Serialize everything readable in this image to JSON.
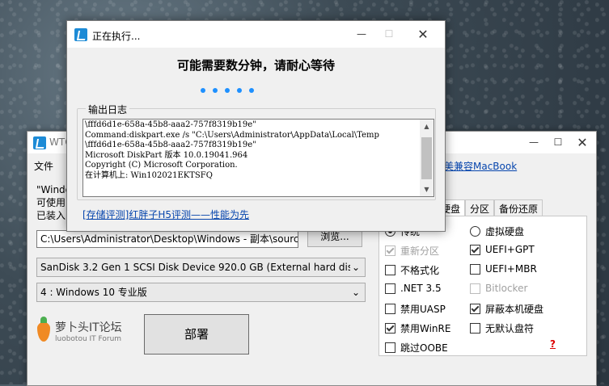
{
  "main": {
    "title": "WTG",
    "menu_file": "文件",
    "top_link": "美兼容MacBook",
    "desc_lines": [
      "\"Windo",
      "可使用",
      "已装入"
    ],
    "path_value": "C:\\Users\\Administrator\\Desktop\\Windows - 副本\\sources",
    "browse_label": "浏览...",
    "disk_value": "SanDisk 3.2 Gen 1 SCSI Disk Device 920.0 GB (External hard disk",
    "edition_value": "4 : Windows 10 专业版",
    "deploy_label": "部署",
    "logo_cn": "萝卜头IT论坛",
    "logo_en": "luobotou IT Forum",
    "tabs": [
      "硬盘",
      "分区",
      "备份还原"
    ],
    "options": {
      "traditional": "传统",
      "vhd": "虚拟硬盘",
      "repartition": "重新分区",
      "uefi_gpt": "UEFI+GPT",
      "no_format": "不格式化",
      "uefi_mbr": "UEFI+MBR",
      "net35": ".NET 3.5",
      "bitlocker": "Bitlocker",
      "disable_uasp": "禁用UASP",
      "hide_local_disk": "屏蔽本机硬盘",
      "disable_winre": "禁用WinRE",
      "no_drive_letter": "无默认盘符",
      "skip_oobe": "跳过OOBE"
    },
    "help": "?"
  },
  "modal": {
    "title": "正在执行...",
    "headline": "可能需要数分钟，请耐心等待",
    "log_legend": "输出日志",
    "log_text": "\\fffd6d1e-658a-45b8-aaa2-757f8319b19e\"\nCommand:diskpart.exe /s \"C:\\Users\\Administrator\\AppData\\Local\\Temp\n\\fffd6d1e-658a-45b8-aaa2-757f8319b19e\"\nMicrosoft DiskPart 版本 10.0.19041.964\nCopyright (C) Microsoft Corporation.\n在计算机上: Win102021EKTSFQ",
    "link": "[存储评测]红胖子H5评测——性能为先"
  },
  "colors": {
    "accent": "#1e90ff",
    "link": "#0645ad",
    "help": "#dd0000"
  }
}
